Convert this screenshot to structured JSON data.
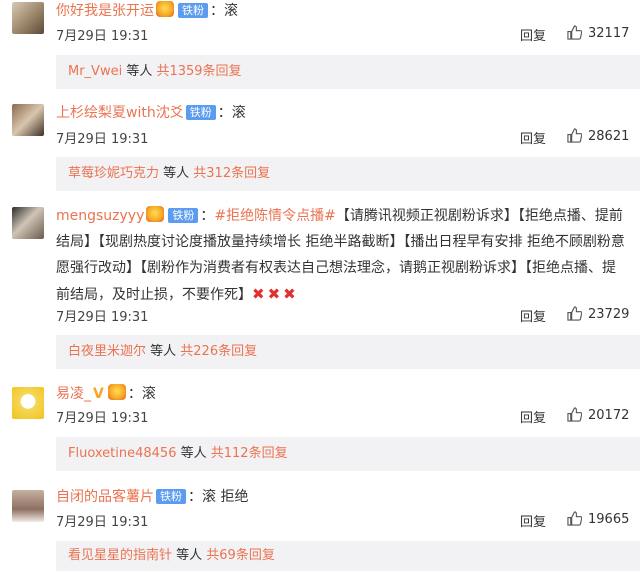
{
  "comments": [
    {
      "username": "你好我是张开运",
      "badge": "铁粉",
      "text": "：滚",
      "time": "7月29日 19:31",
      "reply_label": "回复",
      "likes": "32117",
      "sub": {
        "user": "Mr_Vwei",
        "mid": " 等人 ",
        "count": "共1359条回复"
      }
    },
    {
      "username": "上杉绘梨夏with沈爻",
      "badge": "铁粉",
      "text": "：滚",
      "time": "7月29日 19:31",
      "reply_label": "回复",
      "likes": "28621",
      "sub": {
        "user": "草莓珍妮巧克力",
        "mid": " 等人 ",
        "count": "共312条回复"
      }
    },
    {
      "username": "mengsuzyyy",
      "badge": "铁粉",
      "sep": "：",
      "hashtag": "#拒绝陈情令点播#",
      "text": "【请腾讯视频正视剧粉诉求】【拒绝点播、提前结局】【现剧热度讨论度播放量持续增长 拒绝半路截断】【播出日程早有安排 拒绝不顾剧粉意愿强行改动】【剧粉作为消费者有权表达自己想法理念，请鹅正视剧粉诉求】【拒绝点播、提前结局，及时止损，不要作死】",
      "time": "7月29日 19:31",
      "reply_label": "回复",
      "likes": "23729",
      "sub": {
        "user": "白夜里米迦尔",
        "mid": " 等人 ",
        "count": "共226条回复"
      }
    },
    {
      "username": "易凌_",
      "text": "：滚",
      "time": "7月29日 19:31",
      "reply_label": "回复",
      "likes": "20172",
      "sub": {
        "user": "Fluoxetine48456",
        "mid": " 等人 ",
        "count": "共112条回复"
      }
    },
    {
      "username": "自闭的品客薯片",
      "badge": "铁粉",
      "text": "：滚 拒绝",
      "time": "7月29日 19:31",
      "reply_label": "回复",
      "likes": "19665",
      "sub": {
        "user": "看见星星的指南针",
        "mid": " 等人 ",
        "count": "共69条回复"
      }
    }
  ],
  "icons": {
    "avatar": "avatar",
    "vip": "vip-crown-icon",
    "like": "thumbs-up-icon",
    "cross": "red-cross-emoji",
    "v": "yellow-v-icon"
  },
  "colors": {
    "username": "#eb7350",
    "badge_bg": "#5c9cf0",
    "sub_bg": "#f2f2f5"
  }
}
